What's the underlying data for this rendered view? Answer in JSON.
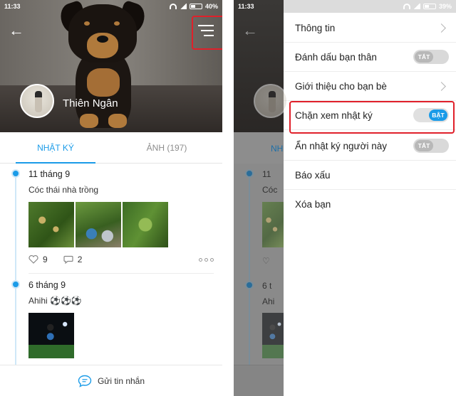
{
  "status_left": {
    "time": "11:33",
    "battery": "40%"
  },
  "status_right": {
    "time": "11:33",
    "battery": "39%"
  },
  "profile": {
    "name": "Thiên Ngân"
  },
  "tabs": [
    {
      "label": "NHẬT KÝ",
      "active": true
    },
    {
      "label": "ẢNH (197)",
      "active": false
    }
  ],
  "posts": [
    {
      "date": "11 tháng 9",
      "text": "Cóc thái nhà trồng",
      "likes": "9",
      "comments": "2"
    },
    {
      "date": "6 tháng 9",
      "text": "Ahihi ⚽⚽⚽"
    }
  ],
  "bottom": {
    "send_message": "Gửi tin nhắn"
  },
  "dim_bg": {
    "date1": "11",
    "text1": "Cóc",
    "date2": "6 t",
    "text2": "Ahi",
    "tab": "NH"
  },
  "drawer": {
    "items": [
      {
        "label": "Thông tin",
        "kind": "chevron"
      },
      {
        "label": "Đánh dấu bạn thân",
        "kind": "toggle",
        "state": "TẮT"
      },
      {
        "label": "Giới thiệu cho bạn bè",
        "kind": "chevron"
      },
      {
        "label": "Chặn xem nhật ký",
        "kind": "toggle",
        "state": "BẬT"
      },
      {
        "label": "Ẩn nhật ký người này",
        "kind": "toggle",
        "state": "TẮT"
      },
      {
        "label": "Báo xấu",
        "kind": "plain"
      },
      {
        "label": "Xóa bạn",
        "kind": "plain"
      }
    ]
  },
  "colors": {
    "accent": "#1a9be8",
    "highlight": "#e0202a"
  }
}
